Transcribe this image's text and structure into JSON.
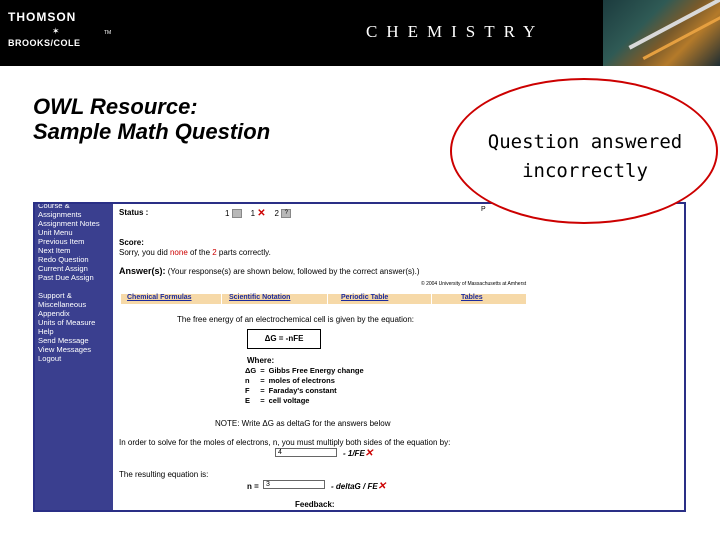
{
  "header": {
    "publisher_top": "THOMSON",
    "publisher_bottom": "BROOKS/COLE",
    "trademark": "TM",
    "subject": "CHEMISTRY"
  },
  "slide": {
    "title_line1": "OWL Resource:",
    "title_line2": "Sample Math Question",
    "callout_line1": "Question answered",
    "callout_line2": "incorrectly"
  },
  "nav": {
    "items": [
      "Course &",
      "Assignments",
      "Assignment Notes",
      "Unit Menu",
      "Previous Item",
      "Next Item",
      "Redo Question",
      "Current Assign",
      "Past Due Assign",
      "",
      "Support &",
      "Miscellaneous",
      "Appendix",
      "Units of Measure",
      "Help",
      "Send Message",
      "View Messages",
      "Logout"
    ]
  },
  "status": {
    "label": "Status :",
    "attempt1": "1",
    "attempt2": "1",
    "attempt3": "2",
    "help_mark": "?",
    "page_mark": "P"
  },
  "score": {
    "label": "Score:",
    "pre": "Sorry, you did ",
    "none": "none",
    "mid": " of the ",
    "count": "2",
    "post": " parts correctly."
  },
  "answer": {
    "label": "Answer(s):",
    "note": "(Your response(s) are shown below, followed by the correct answer(s).)",
    "copyright": "© 2004 University of Massachusetts at Amherst"
  },
  "tabs": [
    "Chemical Formulas",
    "Scientific Notation",
    "Periodic Table",
    "Tables"
  ],
  "question": {
    "intro": "The free energy of an electrochemical cell is given by the equation:",
    "equation": "ΔG = -nFE",
    "where": "Where:",
    "defs": [
      {
        "sym": "ΔG",
        "eq": "=",
        "desc": "Gibbs Free Energy change"
      },
      {
        "sym": "n",
        "eq": "=",
        "desc": "moles of electrons"
      },
      {
        "sym": "F",
        "eq": "=",
        "desc": "Faraday's constant"
      },
      {
        "sym": "E",
        "eq": "=",
        "desc": "cell voltage"
      }
    ],
    "note": "NOTE: Write ΔG as deltaG for the answers below",
    "instruction": "In order to solve for the moles of electrons, n, you must multiply both sides of the equation by:",
    "input1_value": "4",
    "input1_suffix": "- 1/FE",
    "result_label": "The resulting equation is:",
    "n_label": "n =",
    "input2_value": "3",
    "input2_suffix": "- deltaG / FE",
    "mark": "✕",
    "feedback": "Feedback:"
  }
}
